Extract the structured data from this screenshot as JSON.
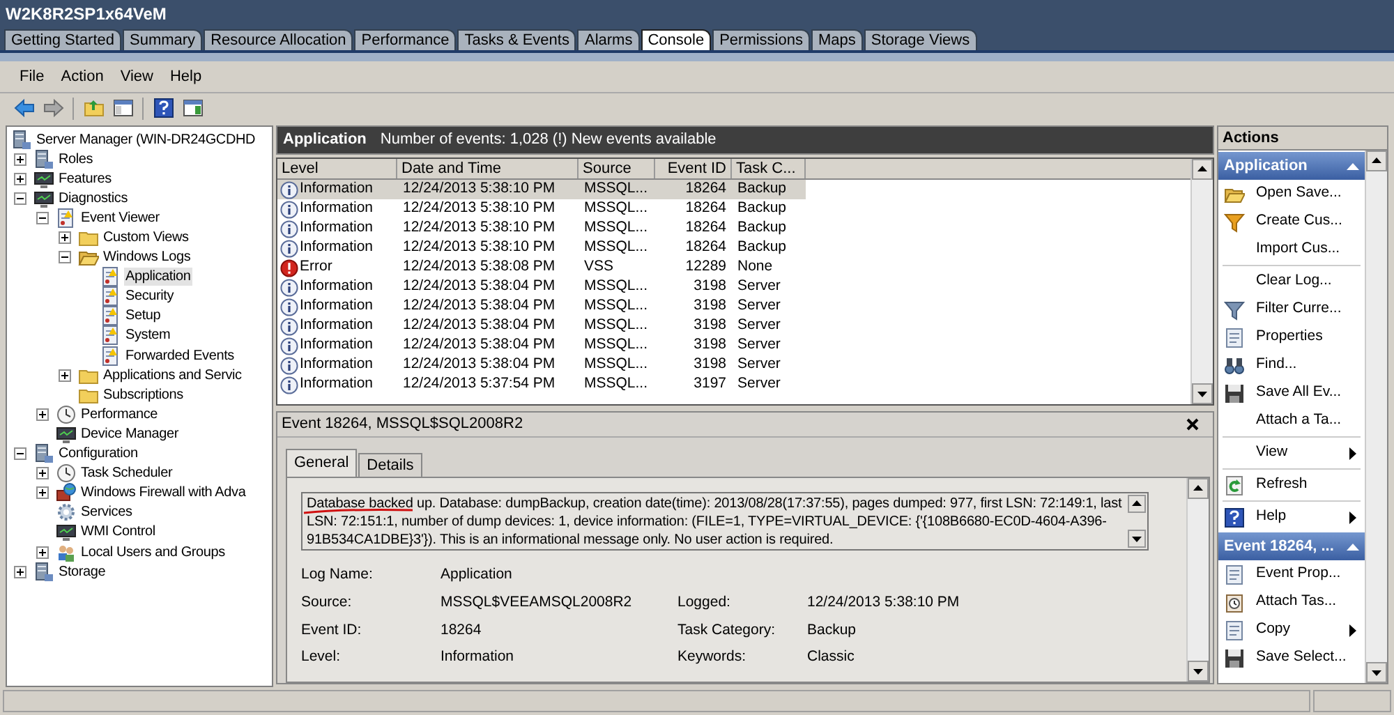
{
  "window": {
    "title": "W2K8R2SP1x64VeM"
  },
  "tabs": [
    {
      "label": "Getting Started",
      "selected": false
    },
    {
      "label": "Summary",
      "selected": false
    },
    {
      "label": "Resource Allocation",
      "selected": false
    },
    {
      "label": "Performance",
      "selected": false
    },
    {
      "label": "Tasks & Events",
      "selected": false
    },
    {
      "label": "Alarms",
      "selected": false
    },
    {
      "label": "Console",
      "selected": true
    },
    {
      "label": "Permissions",
      "selected": false
    },
    {
      "label": "Maps",
      "selected": false
    },
    {
      "label": "Storage Views",
      "selected": false
    }
  ],
  "menu": [
    "File",
    "Action",
    "View",
    "Help"
  ],
  "tree": {
    "label": "Server Manager (WIN-DR24GCDHD",
    "selected": false,
    "children": [
      {
        "label": "Roles",
        "expanded": false,
        "selected": false
      },
      {
        "label": "Features",
        "expanded": false,
        "selected": false
      },
      {
        "label": "Diagnostics",
        "expanded": true,
        "selected": false,
        "children": [
          {
            "label": "Event Viewer",
            "expanded": true,
            "selected": false,
            "children": [
              {
                "label": "Custom Views",
                "expanded": false,
                "selected": false
              },
              {
                "label": "Windows Logs",
                "expanded": true,
                "selected": false,
                "children": [
                  {
                    "label": "Application",
                    "selected": true
                  },
                  {
                    "label": "Security",
                    "selected": false
                  },
                  {
                    "label": "Setup",
                    "selected": false
                  },
                  {
                    "label": "System",
                    "selected": false
                  },
                  {
                    "label": "Forwarded Events",
                    "selected": false
                  }
                ]
              },
              {
                "label": "Applications and Servic",
                "expanded": false,
                "selected": false
              },
              {
                "label": "Subscriptions",
                "selected": false
              }
            ]
          },
          {
            "label": "Performance",
            "expanded": false,
            "selected": false
          },
          {
            "label": "Device Manager",
            "selected": false
          }
        ]
      },
      {
        "label": "Configuration",
        "expanded": true,
        "selected": false,
        "children": [
          {
            "label": "Task Scheduler",
            "expanded": false,
            "selected": false
          },
          {
            "label": "Windows Firewall with Adva",
            "expanded": false,
            "selected": false
          },
          {
            "label": "Services",
            "selected": false
          },
          {
            "label": "WMI Control",
            "selected": false
          },
          {
            "label": "Local Users and Groups",
            "expanded": false,
            "selected": false
          }
        ]
      },
      {
        "label": "Storage",
        "expanded": false,
        "selected": false
      }
    ]
  },
  "log_header": {
    "title": "Application",
    "summary": "Number of events: 1,028 (!) New events available"
  },
  "events": {
    "columns": [
      "Level",
      "Date and Time",
      "Source",
      "Event ID",
      "Task C..."
    ],
    "rows": [
      {
        "kind": "info",
        "level": "Information",
        "date": "12/24/2013 5:38:10 PM",
        "source": "MSSQL...",
        "event_id": "18264",
        "task": "Backup",
        "selected": true
      },
      {
        "kind": "info",
        "level": "Information",
        "date": "12/24/2013 5:38:10 PM",
        "source": "MSSQL...",
        "event_id": "18264",
        "task": "Backup",
        "selected": false
      },
      {
        "kind": "info",
        "level": "Information",
        "date": "12/24/2013 5:38:10 PM",
        "source": "MSSQL...",
        "event_id": "18264",
        "task": "Backup",
        "selected": false
      },
      {
        "kind": "info",
        "level": "Information",
        "date": "12/24/2013 5:38:10 PM",
        "source": "MSSQL...",
        "event_id": "18264",
        "task": "Backup",
        "selected": false
      },
      {
        "kind": "error",
        "level": "Error",
        "date": "12/24/2013 5:38:08 PM",
        "source": "VSS",
        "event_id": "12289",
        "task": "None",
        "selected": false
      },
      {
        "kind": "info",
        "level": "Information",
        "date": "12/24/2013 5:38:04 PM",
        "source": "MSSQL...",
        "event_id": "3198",
        "task": "Server",
        "selected": false
      },
      {
        "kind": "info",
        "level": "Information",
        "date": "12/24/2013 5:38:04 PM",
        "source": "MSSQL...",
        "event_id": "3198",
        "task": "Server",
        "selected": false
      },
      {
        "kind": "info",
        "level": "Information",
        "date": "12/24/2013 5:38:04 PM",
        "source": "MSSQL...",
        "event_id": "3198",
        "task": "Server",
        "selected": false
      },
      {
        "kind": "info",
        "level": "Information",
        "date": "12/24/2013 5:38:04 PM",
        "source": "MSSQL...",
        "event_id": "3198",
        "task": "Server",
        "selected": false
      },
      {
        "kind": "info",
        "level": "Information",
        "date": "12/24/2013 5:38:04 PM",
        "source": "MSSQL...",
        "event_id": "3198",
        "task": "Server",
        "selected": false
      },
      {
        "kind": "info",
        "level": "Information",
        "date": "12/24/2013 5:37:54 PM",
        "source": "MSSQL...",
        "event_id": "3197",
        "task": "Server",
        "selected": false
      }
    ]
  },
  "detail": {
    "title": "Event 18264, MSSQL$SQL2008R2",
    "tabs": [
      {
        "label": "General",
        "selected": true
      },
      {
        "label": "Details",
        "selected": false
      }
    ],
    "message": "Database backed up. Database:  dumpBackup, creation date(time): 2013/08/28(17:37:55), pages dumped: 977, first LSN: 72:149:1, last LSN: 72:151:1, number of dump devices: 1, device information: (FILE=1, TYPE=VIRTUAL_DEVICE: {'{108B6680-EC0D-4604-A396-91B534CA1DBE}3'}). This is an informational message only. No user action is required.",
    "fields": [
      {
        "label": "Log Name:",
        "value": "Application"
      },
      {
        "label": "Source:",
        "value": "MSSQL$VEEAMSQL2008R2",
        "label2": "Logged:",
        "value2": "12/24/2013 5:38:10 PM"
      },
      {
        "label": "Event ID:",
        "value": "18264",
        "label2": "Task Category:",
        "value2": "Backup"
      },
      {
        "label": "Level:",
        "value": "Information",
        "label2": "Keywords:",
        "value2": "Classic"
      }
    ]
  },
  "actions": {
    "title": "Actions",
    "sections": [
      {
        "title": "Application",
        "items": [
          {
            "kind": "item",
            "label": "Open Save...",
            "submenu": false
          },
          {
            "kind": "item",
            "label": "Create Cus...",
            "submenu": false
          },
          {
            "kind": "item",
            "label": "Import Cus...",
            "submenu": false
          },
          {
            "kind": "separator"
          },
          {
            "kind": "item",
            "label": "Clear Log...",
            "submenu": false
          },
          {
            "kind": "item",
            "label": "Filter Curre...",
            "submenu": false
          },
          {
            "kind": "item",
            "label": "Properties",
            "submenu": false
          },
          {
            "kind": "item",
            "label": "Find...",
            "submenu": false
          },
          {
            "kind": "item",
            "label": "Save All Ev...",
            "submenu": false
          },
          {
            "kind": "item",
            "label": "Attach a Ta...",
            "submenu": false
          },
          {
            "kind": "separator"
          },
          {
            "kind": "item",
            "label": "View",
            "submenu": true
          },
          {
            "kind": "separator"
          },
          {
            "kind": "item",
            "label": "Refresh",
            "submenu": false
          },
          {
            "kind": "separator"
          },
          {
            "kind": "item",
            "label": "Help",
            "submenu": true
          }
        ]
      },
      {
        "title": "Event 18264, ...",
        "items": [
          {
            "kind": "item",
            "label": "Event Prop...",
            "submenu": false
          },
          {
            "kind": "item",
            "label": "Attach Tas...",
            "submenu": false
          },
          {
            "kind": "item",
            "label": "Copy",
            "submenu": true
          },
          {
            "kind": "item",
            "label": "Save Select...",
            "submenu": false
          }
        ]
      }
    ]
  }
}
